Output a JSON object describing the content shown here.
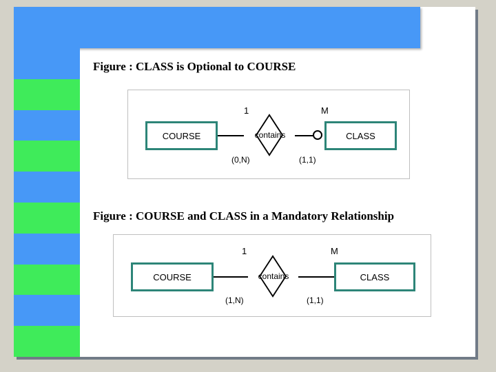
{
  "figure1": {
    "caption": "Figure :  CLASS is Optional to COURSE",
    "left_entity": "COURSE",
    "relationship": "contains",
    "right_entity": "CLASS",
    "left_card_top": "1",
    "right_card_top": "M",
    "left_card_bottom": "(0,N)",
    "right_card_bottom": "(1,1)",
    "has_optional_circle": true
  },
  "figure2": {
    "caption": "Figure :   COURSE and CLASS in a Mandatory Relationship",
    "left_entity": "COURSE",
    "relationship": "contains",
    "right_entity": "CLASS",
    "left_card_top": "1",
    "right_card_top": "M",
    "left_card_bottom": "(1,N)",
    "right_card_bottom": "(1,1)",
    "has_optional_circle": false
  },
  "colors": {
    "blue": "#4798f7",
    "green": "#3feb5a",
    "teal": "#2d8578",
    "bg": "#d4d2c8"
  }
}
